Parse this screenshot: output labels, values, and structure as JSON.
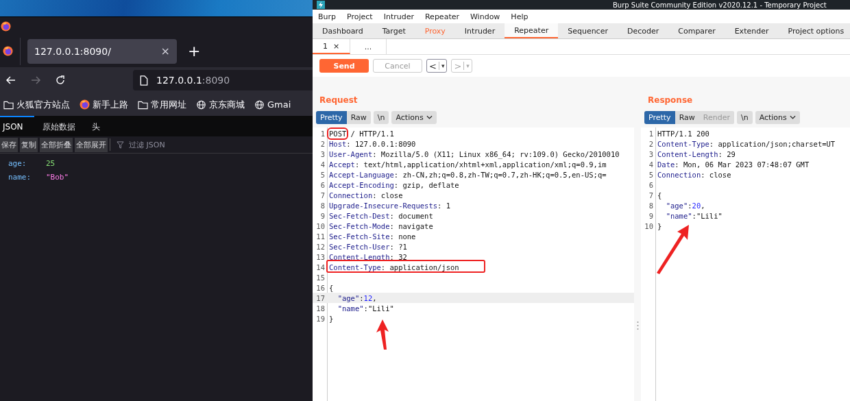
{
  "browser": {
    "tab": {
      "title": "127.0.0.1:8090/",
      "close": "×"
    },
    "new_tab": "+",
    "url": {
      "host": "127.0.0.1",
      "port": ":8090"
    },
    "bookmarks": [
      {
        "kind": "folder",
        "label": "火狐官方站点"
      },
      {
        "kind": "firefox",
        "label": "新手上路"
      },
      {
        "kind": "folder",
        "label": "常用网址"
      },
      {
        "kind": "globe",
        "label": "京东商城"
      },
      {
        "kind": "globe",
        "label": "Gmai"
      }
    ],
    "viewer_tabs": [
      {
        "label": "JSON",
        "selected": true
      },
      {
        "label": "原始数据",
        "selected": false
      },
      {
        "label": "头",
        "selected": false
      }
    ],
    "toolbar_buttons": [
      "保存",
      "复制",
      "全部折叠",
      "全部展开"
    ],
    "filter": {
      "placeholder": "过滤 JSON"
    },
    "rows": [
      {
        "key": "age:",
        "value": "25",
        "kind": "number"
      },
      {
        "key": "name:",
        "value": "\"Bob\"",
        "kind": "string"
      }
    ]
  },
  "burp": {
    "title": "Burp Suite Community Edition v2020.12.1 - Temporary Project",
    "menu": [
      "Burp",
      "Project",
      "Intruder",
      "Repeater",
      "Window",
      "Help"
    ],
    "tabs": [
      {
        "label": "Dashboard",
        "selected": false,
        "highlighted": false
      },
      {
        "label": "Target",
        "selected": false,
        "highlighted": false
      },
      {
        "label": "Proxy",
        "selected": false,
        "highlighted": true
      },
      {
        "label": "Intruder",
        "selected": false,
        "highlighted": false
      },
      {
        "label": "Repeater",
        "selected": true,
        "highlighted": false
      },
      {
        "label": "Sequencer",
        "selected": false,
        "highlighted": false
      },
      {
        "label": "Decoder",
        "selected": false,
        "highlighted": false
      },
      {
        "label": "Comparer",
        "selected": false,
        "highlighted": false
      },
      {
        "label": "Extender",
        "selected": false,
        "highlighted": false
      },
      {
        "label": "Project options",
        "selected": false,
        "highlighted": false
      }
    ],
    "subtabs": [
      {
        "label": "1",
        "close": "×",
        "selected": true
      },
      {
        "label": "...",
        "selected": false
      }
    ],
    "send": "Send",
    "cancel": {
      "label": "Cancel",
      "disabled": true
    },
    "history": [
      {
        "label": "<",
        "caret": "▾",
        "disabled": false
      },
      {
        "label": ">",
        "caret": "▾",
        "disabled": true
      }
    ],
    "panels": [
      {
        "title": "Request",
        "view_buttons": [
          {
            "label": "Pretty",
            "selected": true,
            "disabled": false
          },
          {
            "label": "Raw",
            "selected": false,
            "disabled": false
          }
        ],
        "newline": "\\n",
        "actions": "Actions",
        "lines": [
          {
            "n": "1",
            "segments": [
              {
                "kind": "plain",
                "text": "POST",
                "boxed": true
              },
              {
                "kind": "plain",
                "text": " / HTTP/1.1"
              }
            ]
          },
          {
            "n": "2",
            "segments": [
              {
                "kind": "name",
                "text": "Host"
              },
              {
                "kind": "plain",
                "text": ": 127.0.0.1:8090"
              }
            ]
          },
          {
            "n": "3",
            "segments": [
              {
                "kind": "name",
                "text": "User-Agent"
              },
              {
                "kind": "plain",
                "text": ": Mozilla/5.0 (X11; Linux x86_64; rv:109.0) Gecko/2010010"
              }
            ]
          },
          {
            "n": "4",
            "segments": [
              {
                "kind": "name",
                "text": "Accept"
              },
              {
                "kind": "plain",
                "text": ": text/html,application/xhtml+xml,application/xml;q=0.9,im"
              }
            ]
          },
          {
            "n": "5",
            "segments": [
              {
                "kind": "name",
                "text": "Accept-Language"
              },
              {
                "kind": "plain",
                "text": ": zh-CN,zh;q=0.8,zh-TW;q=0.7,zh-HK;q=0.5,en-US;q="
              }
            ]
          },
          {
            "n": "6",
            "segments": [
              {
                "kind": "name",
                "text": "Accept-Encoding"
              },
              {
                "kind": "plain",
                "text": ": gzip, deflate"
              }
            ]
          },
          {
            "n": "7",
            "segments": [
              {
                "kind": "name",
                "text": "Connection"
              },
              {
                "kind": "plain",
                "text": ": close"
              }
            ]
          },
          {
            "n": "8",
            "segments": [
              {
                "kind": "name",
                "text": "Upgrade-Insecure-Requests"
              },
              {
                "kind": "plain",
                "text": ": 1"
              }
            ]
          },
          {
            "n": "9",
            "segments": [
              {
                "kind": "name",
                "text": "Sec-Fetch-Dest"
              },
              {
                "kind": "plain",
                "text": ": document"
              }
            ]
          },
          {
            "n": "10",
            "segments": [
              {
                "kind": "name",
                "text": "Sec-Fetch-Mode"
              },
              {
                "kind": "plain",
                "text": ": navigate"
              }
            ]
          },
          {
            "n": "11",
            "segments": [
              {
                "kind": "name",
                "text": "Sec-Fetch-Site"
              },
              {
                "kind": "plain",
                "text": ": none"
              }
            ]
          },
          {
            "n": "12",
            "segments": [
              {
                "kind": "name",
                "text": "Sec-Fetch-User"
              },
              {
                "kind": "plain",
                "text": ": ?1"
              }
            ]
          },
          {
            "n": "13",
            "segments": [
              {
                "kind": "name",
                "text": "Content-Length"
              },
              {
                "kind": "plain",
                "text": ": 32"
              }
            ]
          },
          {
            "n": "14",
            "boxed": true,
            "segments": [
              {
                "kind": "name",
                "text": "Content-Type"
              },
              {
                "kind": "plain",
                "text": ": application/json"
              }
            ]
          },
          {
            "n": "15"
          },
          {
            "n": "16",
            "segments": [
              {
                "kind": "plain",
                "text": "{"
              }
            ]
          },
          {
            "n": "17",
            "highlighted": true,
            "segments": [
              {
                "kind": "key",
                "text": "  \"age\""
              },
              {
                "kind": "plain",
                "text": ":"
              },
              {
                "kind": "number",
                "text": "12"
              },
              {
                "kind": "plain",
                "text": ","
              }
            ]
          },
          {
            "n": "18",
            "segments": [
              {
                "kind": "key",
                "text": "  \"name\""
              },
              {
                "kind": "plain",
                "text": ":\"Lili\""
              }
            ]
          },
          {
            "n": "19",
            "segments": [
              {
                "kind": "plain",
                "text": "}"
              }
            ]
          }
        ]
      },
      {
        "title": "Response",
        "view_buttons": [
          {
            "label": "Pretty",
            "selected": true,
            "disabled": false
          },
          {
            "label": "Raw",
            "selected": false,
            "disabled": false
          },
          {
            "label": "Render",
            "selected": false,
            "disabled": true
          }
        ],
        "newline": "\\n",
        "actions": "Actions",
        "lines": [
          {
            "n": "1",
            "segments": [
              {
                "kind": "plain",
                "text": "HTTP/1.1 200"
              }
            ]
          },
          {
            "n": "2",
            "segments": [
              {
                "kind": "name",
                "text": "Content-Type"
              },
              {
                "kind": "plain",
                "text": ": application/json;charset=UT"
              }
            ]
          },
          {
            "n": "3",
            "segments": [
              {
                "kind": "name",
                "text": "Content-Length"
              },
              {
                "kind": "plain",
                "text": ": 29"
              }
            ]
          },
          {
            "n": "4",
            "segments": [
              {
                "kind": "name",
                "text": "Date"
              },
              {
                "kind": "plain",
                "text": ": Mon, 06 Mar 2023 07:48:07 GMT"
              }
            ]
          },
          {
            "n": "5",
            "segments": [
              {
                "kind": "name",
                "text": "Connection"
              },
              {
                "kind": "plain",
                "text": ": close"
              }
            ]
          },
          {
            "n": "6"
          },
          {
            "n": "7",
            "segments": [
              {
                "kind": "plain",
                "text": "{"
              }
            ]
          },
          {
            "n": "8",
            "segments": [
              {
                "kind": "key",
                "text": "  \"age\""
              },
              {
                "kind": "plain",
                "text": ":"
              },
              {
                "kind": "number",
                "text": "20"
              },
              {
                "kind": "plain",
                "text": ","
              }
            ]
          },
          {
            "n": "9",
            "segments": [
              {
                "kind": "key",
                "text": "  \"name\""
              },
              {
                "kind": "plain",
                "text": ":\"Lili\""
              }
            ]
          },
          {
            "n": "10",
            "segments": [
              {
                "kind": "plain",
                "text": "}"
              }
            ]
          }
        ]
      }
    ]
  }
}
